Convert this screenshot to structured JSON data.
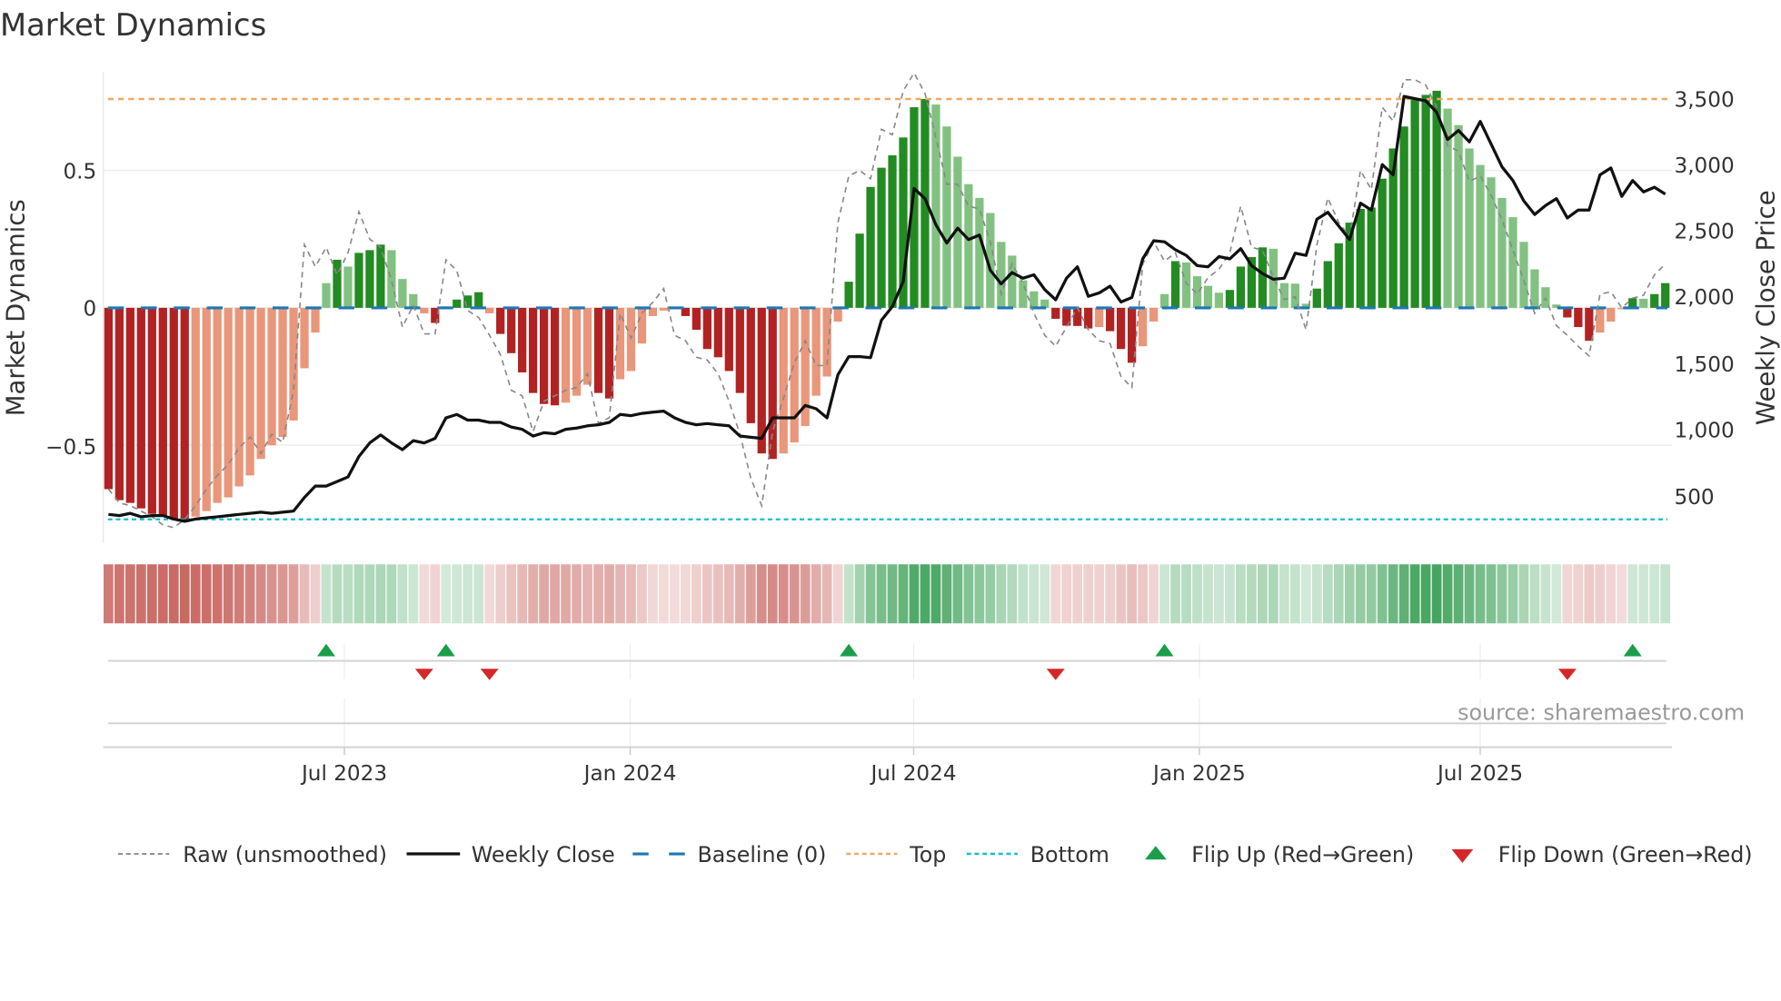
{
  "title": "Market Dynamics",
  "source": "source: sharemaestro.com",
  "colors": {
    "strong_negative": "#b22222",
    "weak_negative": "#e9967a",
    "strong_positive": "#228b22",
    "weak_positive": "#82c182",
    "raw": "#888888",
    "close": "#111111",
    "baseline": "#1f77b4",
    "top": "#f0a860",
    "bottom": "#17becf",
    "flip_up": "#1a9e4a",
    "flip_down": "#d62728"
  },
  "chart_data": {
    "type": "bar",
    "title": "Market Dynamics",
    "ylabel": "Market Dynamics",
    "y2label": "Weekly Close Price",
    "ylim": [
      -0.855,
      0.86
    ],
    "y2lim": [
      139,
      3698
    ],
    "y_ticks": [
      {
        "value": 0.5,
        "label": "0.5"
      },
      {
        "value": 0,
        "label": "0"
      },
      {
        "value": -0.5,
        "label": "−0.5"
      }
    ],
    "y2_ticks": [
      {
        "value": 3500,
        "label": "3,500"
      },
      {
        "value": 3000,
        "label": "3,000"
      },
      {
        "value": 2500,
        "label": "2,500"
      },
      {
        "value": 2000,
        "label": "2,000"
      },
      {
        "value": 1500,
        "label": "1,500"
      },
      {
        "value": 1000,
        "label": "1,000"
      },
      {
        "value": 500,
        "label": "500"
      }
    ],
    "x_ticks": [
      {
        "week_index": 21.67,
        "label": "Jul 2023"
      },
      {
        "week_index": 47.92,
        "label": "Jan 2024"
      },
      {
        "week_index": 73.96,
        "label": "Jul 2024"
      },
      {
        "week_index": 100.2,
        "label": "Jan 2025"
      },
      {
        "week_index": 126.0,
        "label": "Jul 2025"
      }
    ],
    "top_level": 0.76,
    "bottom_level": -0.77,
    "baseline": 0,
    "series": [
      {
        "name": "Market Dynamics (smoothed)",
        "values": [
          -0.66,
          -0.7,
          -0.71,
          -0.73,
          -0.75,
          -0.76,
          -0.77,
          -0.78,
          -0.76,
          -0.74,
          -0.71,
          -0.69,
          -0.65,
          -0.61,
          -0.55,
          -0.5,
          -0.47,
          -0.41,
          -0.22,
          -0.09,
          0.09,
          0.175,
          0.15,
          0.2,
          0.21,
          0.23,
          0.21,
          0.105,
          0.05,
          -0.02,
          -0.055,
          0.005,
          0.03,
          0.045,
          0.057,
          -0.02,
          -0.095,
          -0.165,
          -0.235,
          -0.31,
          -0.35,
          -0.355,
          -0.345,
          -0.32,
          -0.28,
          -0.31,
          -0.33,
          -0.26,
          -0.23,
          -0.13,
          -0.03,
          -0.01,
          -0.005,
          -0.03,
          -0.08,
          -0.15,
          -0.18,
          -0.23,
          -0.31,
          -0.42,
          -0.53,
          -0.55,
          -0.53,
          -0.49,
          -0.43,
          -0.32,
          -0.25,
          -0.05,
          0.095,
          0.27,
          0.44,
          0.51,
          0.555,
          0.62,
          0.73,
          0.76,
          0.74,
          0.66,
          0.55,
          0.45,
          0.4,
          0.345,
          0.24,
          0.19,
          0.1,
          0.06,
          0.03,
          -0.04,
          -0.065,
          -0.066,
          -0.075,
          -0.07,
          -0.085,
          -0.15,
          -0.2,
          -0.14,
          -0.05,
          0.05,
          0.17,
          0.165,
          0.115,
          0.08,
          0.055,
          0.065,
          0.15,
          0.185,
          0.22,
          0.215,
          0.09,
          0.088,
          0.015,
          0.07,
          0.17,
          0.235,
          0.31,
          0.36,
          0.365,
          0.47,
          0.58,
          0.66,
          0.76,
          0.775,
          0.79,
          0.725,
          0.665,
          0.58,
          0.52,
          0.475,
          0.4,
          0.33,
          0.24,
          0.14,
          0.075,
          0.012,
          -0.035,
          -0.07,
          -0.12,
          -0.09,
          -0.05,
          -0.005,
          0.035,
          0.033,
          0.05,
          0.09
        ]
      },
      {
        "name": "Raw (unsmoothed)",
        "values": [
          -0.66,
          -0.71,
          -0.72,
          -0.74,
          -0.76,
          -0.79,
          -0.8,
          -0.77,
          -0.72,
          -0.66,
          -0.61,
          -0.57,
          -0.51,
          -0.47,
          -0.53,
          -0.46,
          -0.49,
          -0.3,
          0.23,
          0.15,
          0.22,
          0.12,
          0.2,
          0.35,
          0.25,
          0.22,
          0.1,
          -0.07,
          0.01,
          -0.095,
          -0.095,
          0.175,
          0.135,
          -0.01,
          -0.035,
          -0.1,
          -0.17,
          -0.3,
          -0.32,
          -0.45,
          -0.34,
          -0.32,
          -0.3,
          -0.29,
          -0.24,
          -0.42,
          -0.4,
          -0.02,
          -0.11,
          -0.02,
          0.02,
          0.07,
          -0.1,
          -0.12,
          -0.18,
          -0.19,
          -0.24,
          -0.34,
          -0.46,
          -0.62,
          -0.72,
          -0.45,
          -0.33,
          -0.2,
          -0.12,
          -0.21,
          -0.21,
          0.31,
          0.48,
          0.5,
          0.47,
          0.65,
          0.63,
          0.79,
          0.855,
          0.78,
          0.62,
          0.45,
          0.45,
          0.37,
          0.36,
          0.24,
          0.05,
          0.16,
          0.09,
          -0.02,
          -0.1,
          -0.14,
          -0.07,
          0.0,
          -0.08,
          -0.12,
          -0.13,
          -0.25,
          -0.29,
          0.16,
          0.24,
          0.17,
          0.2,
          0.09,
          0.05,
          0.11,
          0.14,
          0.2,
          0.37,
          0.22,
          0.21,
          0.11,
          0.03,
          0.04,
          -0.08,
          0.23,
          0.4,
          0.31,
          0.26,
          0.5,
          0.43,
          0.73,
          0.68,
          0.83,
          0.83,
          0.81,
          0.73,
          0.59,
          0.57,
          0.46,
          0.48,
          0.41,
          0.32,
          0.21,
          0.1,
          -0.02,
          0.035,
          -0.065,
          -0.1,
          -0.14,
          -0.175,
          0.05,
          0.058,
          0.0,
          0.035,
          0.046,
          0.12,
          0.16
        ]
      },
      {
        "name": "Weekly Close",
        "axis": "right",
        "values": [
          353,
          344,
          361,
          335,
          344,
          344,
          318,
          301,
          318,
          327,
          335,
          344,
          353,
          361,
          370,
          361,
          370,
          378,
          481,
          567,
          567,
          601,
          636,
          790,
          893,
          953,
          893,
          842,
          910,
          893,
          927,
          1082,
          1108,
          1065,
          1065,
          1048,
          1048,
          1013,
          996,
          945,
          970,
          962,
          996,
          1005,
          1022,
          1030,
          1048,
          1108,
          1099,
          1116,
          1125,
          1133,
          1082,
          1048,
          1030,
          1039,
          1030,
          1022,
          945,
          936,
          927,
          1082,
          1082,
          1082,
          1176,
          1151,
          1082,
          1408,
          1545,
          1545,
          1537,
          1820,
          1923,
          2112,
          2815,
          2738,
          2541,
          2403,
          2515,
          2429,
          2463,
          2197,
          2094,
          2180,
          2137,
          2163,
          2051,
          1974,
          2137,
          2223,
          2000,
          2026,
          2077,
          1957,
          1991,
          2283,
          2420,
          2412,
          2352,
          2309,
          2232,
          2223,
          2300,
          2283,
          2360,
          2232,
          2172,
          2129,
          2137,
          2326,
          2309,
          2583,
          2635,
          2532,
          2429,
          2704,
          2652,
          2995,
          2918,
          3510,
          3493,
          3476,
          3390,
          3184,
          3253,
          3167,
          3321,
          3150,
          2978,
          2875,
          2721,
          2618,
          2686,
          2738,
          2592,
          2652,
          2652,
          2918,
          2970,
          2755,
          2875,
          2789,
          2824,
          2772
        ]
      }
    ],
    "legend_position": "bottom",
    "legend": [
      "Raw (unsmoothed)",
      "Weekly Close",
      "Baseline (0)",
      "Top",
      "Bottom",
      "Flip Up (Red→Green)",
      "Flip Down (Green→Red)"
    ]
  }
}
